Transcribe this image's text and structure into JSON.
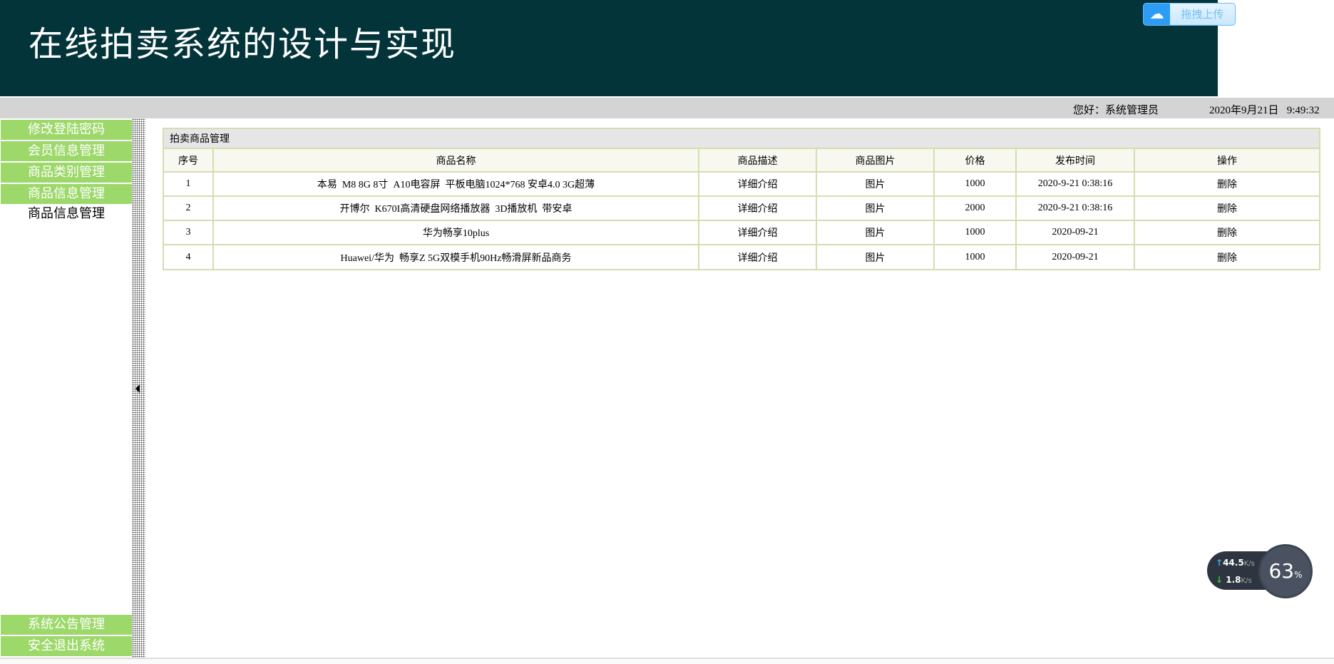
{
  "header": {
    "title": "在线拍卖系统的设计与实现",
    "upload_label": "拖拽上传",
    "upload_icon": "cloud-icon"
  },
  "topbar": {
    "greeting": "您好：系统管理员",
    "datetime": "2020年9月21日   9:49:32"
  },
  "sidebar": {
    "items": [
      {
        "label": "修改登陆密码"
      },
      {
        "label": "会员信息管理"
      },
      {
        "label": "商品类别管理"
      },
      {
        "label": "商品信息管理"
      }
    ],
    "sub_items": [
      {
        "label": "商品信息管理"
      }
    ],
    "bottom_items": [
      {
        "label": "系统公告管理"
      },
      {
        "label": "安全退出系统"
      }
    ]
  },
  "panel": {
    "title": "拍卖商品管理",
    "columns": [
      "序号",
      "商品名称",
      "商品描述",
      "商品图片",
      "价格",
      "发布时间",
      "操作"
    ],
    "rows": [
      {
        "no": "1",
        "name": "本易  M8 8G 8寸  A10电容屏  平板电脑1024*768 安卓4.0 3G超薄",
        "desc": "详细介绍",
        "pic": "图片",
        "price": "1000",
        "time": "2020-9-21 0:38:16",
        "op": "删除"
      },
      {
        "no": "2",
        "name": "开博尔  K670I高清硬盘网络播放器  3D播放机  带安卓",
        "desc": "详细介绍",
        "pic": "图片",
        "price": "2000",
        "time": "2020-9-21 0:38:16",
        "op": "删除"
      },
      {
        "no": "3",
        "name": "华为畅享10plus",
        "desc": "详细介绍",
        "pic": "图片",
        "price": "1000",
        "time": "2020-09-21",
        "op": "删除"
      },
      {
        "no": "4",
        "name": "Huawei/华为  畅享Z 5G双模手机90Hz畅滑屏新品商务",
        "desc": "详细介绍",
        "pic": "图片",
        "price": "1000",
        "time": "2020-09-21",
        "op": "删除"
      }
    ]
  },
  "widget": {
    "upload_speed": "44.5",
    "download_speed": "1.8",
    "unit": "K/s",
    "percent": "63",
    "percent_sign": "%"
  }
}
